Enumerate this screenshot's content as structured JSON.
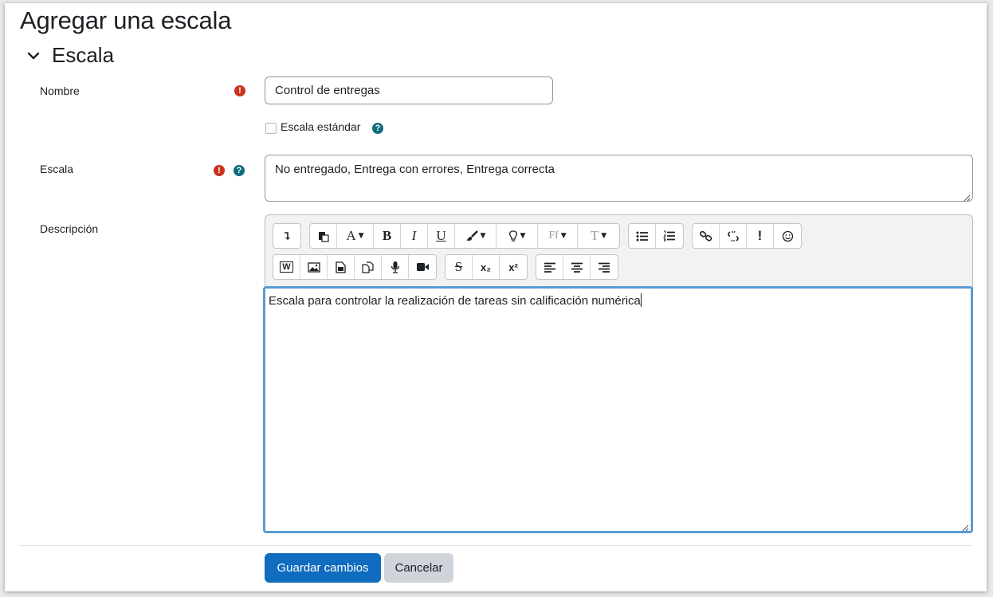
{
  "page": {
    "title": "Agregar una escala"
  },
  "section": {
    "title": "Escala"
  },
  "fields": {
    "name": {
      "label": "Nombre",
      "value": "Control de entregas"
    },
    "standard": {
      "label": "Escala estándar",
      "checked": false
    },
    "scale": {
      "label": "Escala",
      "value": "No entregado, Entrega con errores, Entrega correcta"
    },
    "description": {
      "label": "Descripción",
      "value": "Escala para controlar la realización de tareas sin calificación numérica"
    }
  },
  "toolbar": {
    "bold": "B",
    "italic": "I",
    "underline": "U",
    "font_family": "Ff",
    "font_size": "T",
    "strike": "S",
    "subscript": "x₂",
    "superscript": "x²",
    "word": "W",
    "alert": "!"
  },
  "buttons": {
    "save": "Guardar cambios",
    "cancel": "Cancelar"
  },
  "colors": {
    "primary": "#0f6cbf",
    "required": "#ca3120",
    "help": "#0f6b7e",
    "focus": "#5b9bd5"
  },
  "icons": {
    "required": "exclamation-circle-icon",
    "help": "question-circle-icon",
    "section_toggle": "chevron-down-icon"
  }
}
